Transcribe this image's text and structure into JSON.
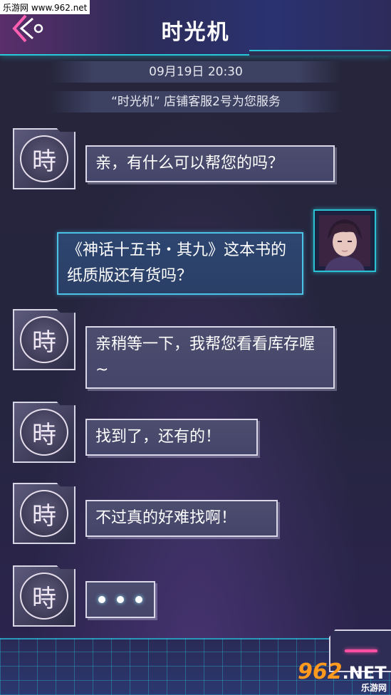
{
  "watermark_top": "乐游网 www.962.net",
  "header": {
    "title": "时光机"
  },
  "session": {
    "datetime": "09月19日  20:30",
    "service_text": "“时光机” 店铺客服2号为您服务"
  },
  "agent_avatar_glyph": "時",
  "messages": [
    {
      "from": "agent",
      "text": "亲，有什么可以帮您的吗？"
    },
    {
      "from": "user",
      "text": "《神话十五书・其九》这本书的纸质版还有货吗？"
    },
    {
      "from": "agent",
      "text": "亲稍等一下，我帮您看看库存喔~"
    },
    {
      "from": "agent",
      "text": "找到了，还有的！"
    },
    {
      "from": "agent",
      "text": "不过真的好难找啊！"
    },
    {
      "from": "agent",
      "typing": true
    }
  ],
  "watermark_bottom": {
    "brand": "962",
    "suffix": ".NET",
    "subtitle": "乐游网"
  },
  "colors": {
    "accent_cyan": "#27c9d8",
    "accent_pink": "#ff4fa3",
    "background": "#242338"
  },
  "icons": {
    "back": "back-chevron-icon",
    "input": "input-button-icon"
  }
}
